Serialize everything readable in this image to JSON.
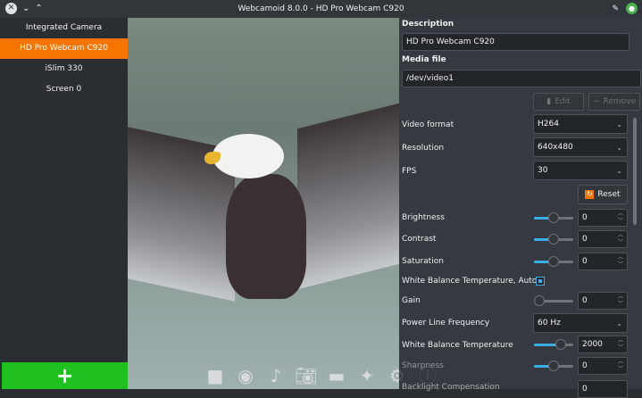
{
  "window": {
    "title": "Webcamoid 8.0.0 - HD Pro Webcam C920"
  },
  "devices": [
    {
      "label": "Integrated Camera"
    },
    {
      "label": "HD Pro Webcam C920",
      "selected": true
    },
    {
      "label": "iSlim 330"
    },
    {
      "label": "Screen 0"
    }
  ],
  "add_button": "+",
  "panel": {
    "description_label": "Description",
    "description_value": "HD Pro Webcam C920",
    "media_label": "Media file",
    "media_value": "/dev/video1",
    "edit": "Edit",
    "remove": "Remove",
    "reset": "Reset",
    "video_format": {
      "label": "Video format",
      "value": "H264"
    },
    "resolution": {
      "label": "Resolution",
      "value": "640x480"
    },
    "fps": {
      "label": "FPS",
      "value": "30"
    },
    "brightness": {
      "label": "Brightness",
      "value": "0",
      "level": 0.5
    },
    "contrast": {
      "label": "Contrast",
      "value": "0",
      "level": 0.5
    },
    "saturation": {
      "label": "Saturation",
      "value": "0",
      "level": 0.5
    },
    "wb_auto": {
      "label": "White Balance Temperature, Auto",
      "checked": true
    },
    "gain": {
      "label": "Gain",
      "value": "0",
      "level": 0
    },
    "power_line": {
      "label": "Power Line Frequency",
      "value": "60 Hz"
    },
    "wb_temp": {
      "label": "White Balance Temperature",
      "value": "2000",
      "level": 0.75
    },
    "sharpness": {
      "label": "Sharpness",
      "value": "0",
      "level": 0.5
    },
    "backlight": {
      "label": "Backlight Compensation",
      "value": "0"
    }
  },
  "colors": {
    "accent": "#3daee9",
    "selected": "#f67400",
    "add": "#1fc01f"
  }
}
